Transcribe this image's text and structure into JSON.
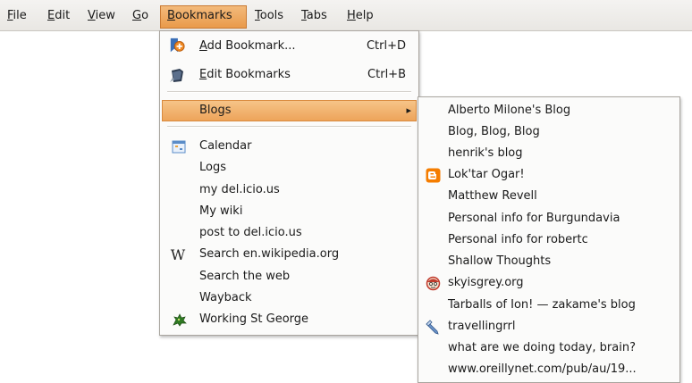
{
  "menubar": {
    "items": [
      "File",
      "Edit",
      "View",
      "Go",
      "Bookmarks",
      "Tools",
      "Tabs",
      "Help"
    ]
  },
  "bookmarks_menu": {
    "add_bookmark": {
      "label": "Add Bookmark...",
      "shortcut": "Ctrl+D"
    },
    "edit_bookmarks": {
      "label": "Edit Bookmarks",
      "shortcut": "Ctrl+B"
    },
    "blogs": {
      "label": "Blogs",
      "arrow": "▸"
    },
    "items": [
      "Calendar",
      "Logs",
      "my del.icio.us",
      "My wiki",
      "post to del.icio.us",
      "Search en.wikipedia.org",
      "Search the web",
      "Wayback",
      "Working St George"
    ]
  },
  "blogs_submenu": {
    "items": [
      "Alberto Milone's Blog",
      "Blog, Blog, Blog",
      "henrik's blog",
      "Lok'tar Ogar!",
      "Matthew Revell",
      "Personal info for Burgundavia",
      "Personal info for robertc",
      "Shallow Thoughts",
      "skyisgrey.org",
      "Tarballs of Ion! — zakame's blog",
      "travellingrrl",
      "what are we doing today, brain?",
      "www.oreillynet.com/pub/au/19..."
    ]
  },
  "icons": {
    "add_bookmark": "add-bookmark-icon",
    "edit_bookmarks": "edit-bookmarks-icon",
    "calendar": "calendar-icon",
    "wikipedia": "wikipedia-icon",
    "working_st_george": "dragon-icon",
    "loktar": "blogger-icon",
    "skyisgrey": "face-icon",
    "travellingrrl": "pencil-icon"
  },
  "colors": {
    "highlight": "#eda45a",
    "menubar_bg": "#ecebe8",
    "menu_bg": "#fbfbfa"
  }
}
